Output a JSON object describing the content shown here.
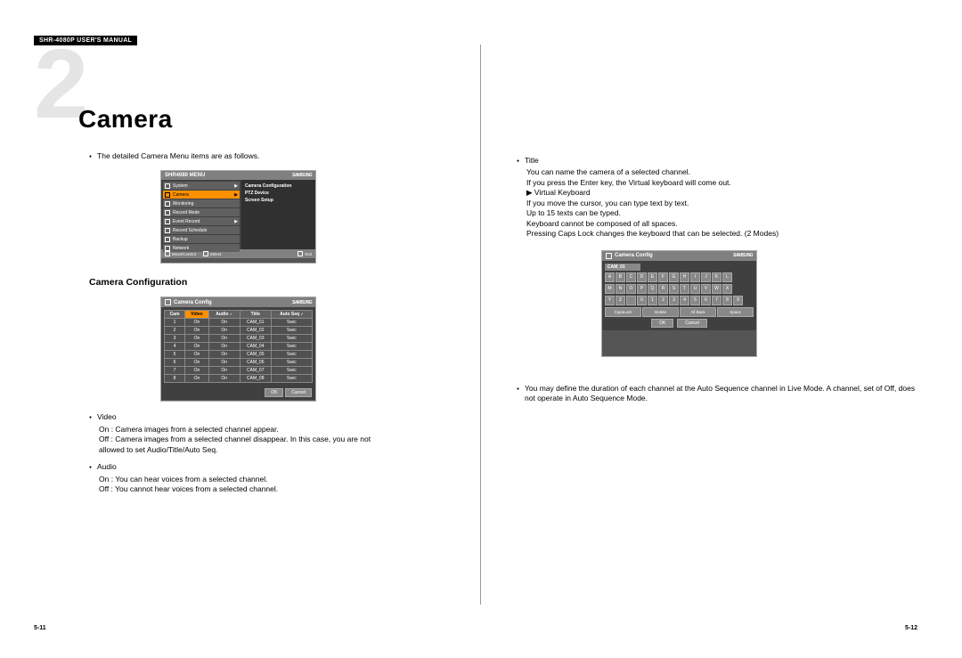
{
  "header": "SHR-4080P USER'S MANUAL",
  "chapter_number": "2",
  "chapter_title": "Camera",
  "left": {
    "intro": "The detailed Camera Menu items are as follows.",
    "section_heading": "Camera Configuration",
    "menu_ss": {
      "title": "SHR4080 MENU",
      "logo": "SAMSUNG",
      "items": [
        {
          "label": "System",
          "arrow": "▶"
        },
        {
          "label": "Camera",
          "arrow": "▶",
          "sel": true
        },
        {
          "label": "Monitoring",
          "arrow": ""
        },
        {
          "label": "Record Mode",
          "arrow": ""
        },
        {
          "label": "Event Record",
          "arrow": "▶"
        },
        {
          "label": "Record Schedule",
          "arrow": ""
        },
        {
          "label": "Backup",
          "arrow": ""
        },
        {
          "label": "Network",
          "arrow": ""
        }
      ],
      "subs": [
        "Camera Configuration",
        "PTZ Device",
        "Screen Setup"
      ],
      "footer": [
        "Move/Control",
        "Select",
        "Exit"
      ]
    },
    "table_ss": {
      "title": "Camera Config",
      "logo": "SAMSUNG",
      "headers": [
        "Cam",
        "Video",
        "Audio",
        "Title",
        "Auto Seq"
      ],
      "check_col": 2,
      "check_col2": 4,
      "sel_col": 1,
      "rows": [
        [
          "1",
          "On",
          "On",
          "CAM_01",
          "5sec"
        ],
        [
          "2",
          "On",
          "On",
          "CAM_02",
          "5sec"
        ],
        [
          "3",
          "On",
          "On",
          "CAM_03",
          "5sec"
        ],
        [
          "4",
          "On",
          "On",
          "CAM_04",
          "5sec"
        ],
        [
          "5",
          "On",
          "On",
          "CAM_05",
          "5sec"
        ],
        [
          "6",
          "On",
          "On",
          "CAM_06",
          "5sec"
        ],
        [
          "7",
          "On",
          "On",
          "CAM_07",
          "5sec"
        ],
        [
          "8",
          "On",
          "On",
          "CAM_08",
          "5sec"
        ]
      ],
      "buttons": [
        "OK",
        "Cancel"
      ]
    },
    "bullets": [
      {
        "title": "Video",
        "lines": [
          "On : Camera images from a selected channel appear.",
          "Off : Camera images from a selected channel disappear. In this case, you are not",
          "         allowed to set Audio/Title/Auto Seq."
        ]
      },
      {
        "title": "Audio",
        "lines": [
          "On : You can hear voices from a selected channel.",
          "Off : You cannot hear voices from a selected channel."
        ]
      }
    ],
    "page_number": "5-11"
  },
  "right": {
    "title_bullet": {
      "title": "Title",
      "lines": [
        "You can name the camera of a selected channel.",
        "If you press the Enter key, the Virtual keyboard will come out.",
        "▶ Virtual Keyboard",
        "   If you move the cursor, you can type text by text.",
        "   Up to 15 texts can be typed.",
        "   Keyboard cannot be composed of all spaces.",
        "   Pressing Caps Lock changes the keyboard that can be selected. (2 Modes)"
      ]
    },
    "kbd_ss": {
      "title": "Camera Config",
      "logo": "SAMSUNG",
      "field": "CAM_01",
      "rows": [
        [
          "A",
          "B",
          "C",
          "D",
          "E",
          "F",
          "G",
          "H",
          "I",
          "J",
          "K",
          "L"
        ],
        [
          "M",
          "N",
          "O",
          "P",
          "Q",
          "R",
          "S",
          "T",
          "U",
          "V",
          "W",
          "X"
        ],
        [
          "Y",
          "Z",
          " ",
          "0",
          "1",
          "2",
          "3",
          "4",
          "5",
          "6",
          "7",
          "8",
          "9"
        ]
      ],
      "specials": [
        "CapsLock",
        "Delete",
        "All Back",
        "Space"
      ],
      "buttons": [
        "OK",
        "Cancel"
      ]
    },
    "autoseq_bullet": "You may define the duration of each channel at the Auto Sequence channel in Live Mode. A channel, set of Off, does not operate in Auto Sequence Mode.",
    "page_number": "5-12"
  }
}
